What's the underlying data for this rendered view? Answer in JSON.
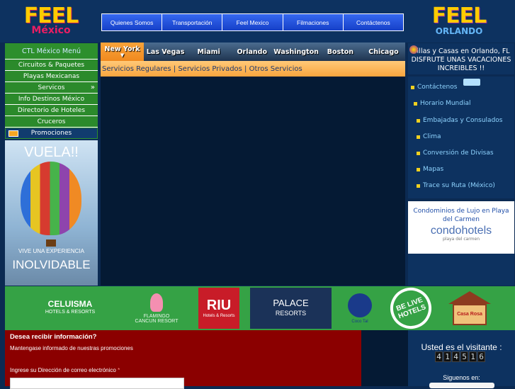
{
  "header": {
    "logo_left": {
      "big": "FEEL",
      "small": "México"
    },
    "logo_right": {
      "big": "FEEL",
      "small": "ORLANDO"
    },
    "nav": [
      "Quienes Somos",
      "Transportación",
      "Feel Mexico",
      "Filmaciones",
      "Contáctenos"
    ]
  },
  "left_menu": {
    "title": "CTL México Menú",
    "items": [
      "Circuitos & Paquetes",
      "Playas Mexicanas",
      "Servicos",
      "Info Destinos México",
      "Directorio de Hoteles",
      "Cruceros",
      "Promociones"
    ],
    "arrow": "»",
    "active_index": 6
  },
  "promo_banner": {
    "title": "VUELA!!",
    "line1": "VIVE UNA EXPERIENCIA",
    "line2": "INOLVIDABLE"
  },
  "city_tabs": {
    "items": [
      "New York",
      "Las Vegas",
      "Miami",
      "Orlando",
      "Washington",
      "Boston",
      "Chicago"
    ],
    "active_index": 0,
    "active_marker": "▼"
  },
  "services_bar": {
    "text": "Servicios Regulares | Servicios Privados | Otros Servicios"
  },
  "right": {
    "orlando_promo": "Villas y Casas en Orlando, FL DISFRUTE UNAS VACACIONES INCREIBLES !!",
    "links": [
      "Contáctenos",
      "Horario Mundial",
      "Embajadas y Consulados",
      "Clima",
      "Conversión de Divisas",
      "Mapas",
      "Trace su Ruta (México)"
    ],
    "condo": {
      "title": "Condominios de Lujo en Playa del Carmen",
      "logo": "condohotels",
      "logo_sub": "playa del carmen"
    }
  },
  "partners": {
    "celuisma": {
      "name": "CELUISMA",
      "sub": "HOTELS & RESORTS"
    },
    "flamingo": {
      "name": "FLAMINGO",
      "sub": "CANCUN RESORT"
    },
    "riu": {
      "name": "RIU",
      "sub": "Hotels & Resorts"
    },
    "palace": {
      "name": "PALACE",
      "sub": "RESORTS"
    },
    "cocotal": {
      "name": "Coco Tal",
      "sub": "Golf Resort"
    },
    "belive": {
      "name": "BE LIVE HOTELS"
    },
    "house": {
      "name": "Casa Rosa"
    }
  },
  "newsletter": {
    "title": "Desea recibir información?",
    "subtitle": "Mantengase informado de nuestras promociones",
    "email_label": "Ingrese su Dirección de correo electrónico",
    "required_mark": "*",
    "email_value": ""
  },
  "visitor": {
    "label": "Usted es el visitante :",
    "count_digits": [
      "4",
      "1",
      "4",
      "5",
      "1",
      "6"
    ],
    "follow_label": "Siguenos en:"
  }
}
